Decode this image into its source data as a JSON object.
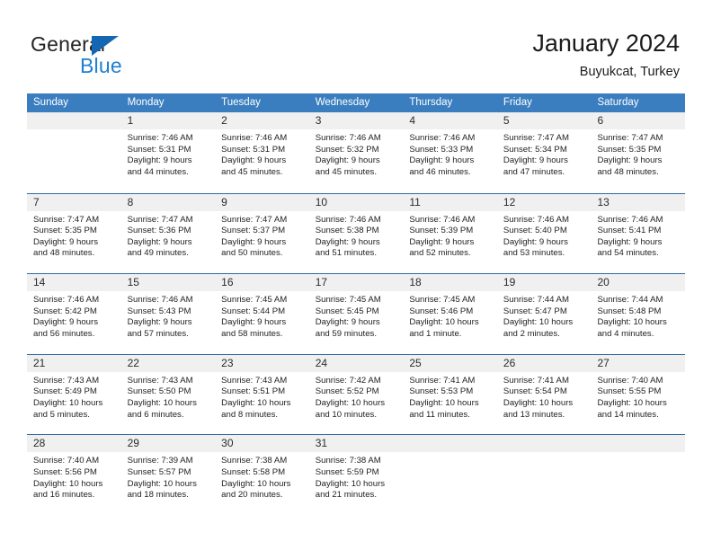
{
  "brand": {
    "name_top": "General",
    "name_bottom": "Blue",
    "triangle_color": "#1567b3",
    "blue_color": "#1f7fd0"
  },
  "header": {
    "title": "January 2024",
    "subtitle": "Buyukcat, Turkey"
  },
  "colors": {
    "header_row_bg": "#3a7ebf",
    "row_divider": "#2e6da4",
    "day_strip_bg": "#f0f0f0",
    "text": "#232323"
  },
  "weekdays": [
    "Sunday",
    "Monday",
    "Tuesday",
    "Wednesday",
    "Thursday",
    "Friday",
    "Saturday"
  ],
  "weeks": [
    [
      {
        "day": "",
        "sunrise": "",
        "sunset": "",
        "daylight1": "",
        "daylight2": ""
      },
      {
        "day": "1",
        "sunrise": "Sunrise: 7:46 AM",
        "sunset": "Sunset: 5:31 PM",
        "daylight1": "Daylight: 9 hours",
        "daylight2": "and 44 minutes."
      },
      {
        "day": "2",
        "sunrise": "Sunrise: 7:46 AM",
        "sunset": "Sunset: 5:31 PM",
        "daylight1": "Daylight: 9 hours",
        "daylight2": "and 45 minutes."
      },
      {
        "day": "3",
        "sunrise": "Sunrise: 7:46 AM",
        "sunset": "Sunset: 5:32 PM",
        "daylight1": "Daylight: 9 hours",
        "daylight2": "and 45 minutes."
      },
      {
        "day": "4",
        "sunrise": "Sunrise: 7:46 AM",
        "sunset": "Sunset: 5:33 PM",
        "daylight1": "Daylight: 9 hours",
        "daylight2": "and 46 minutes."
      },
      {
        "day": "5",
        "sunrise": "Sunrise: 7:47 AM",
        "sunset": "Sunset: 5:34 PM",
        "daylight1": "Daylight: 9 hours",
        "daylight2": "and 47 minutes."
      },
      {
        "day": "6",
        "sunrise": "Sunrise: 7:47 AM",
        "sunset": "Sunset: 5:35 PM",
        "daylight1": "Daylight: 9 hours",
        "daylight2": "and 48 minutes."
      }
    ],
    [
      {
        "day": "7",
        "sunrise": "Sunrise: 7:47 AM",
        "sunset": "Sunset: 5:35 PM",
        "daylight1": "Daylight: 9 hours",
        "daylight2": "and 48 minutes."
      },
      {
        "day": "8",
        "sunrise": "Sunrise: 7:47 AM",
        "sunset": "Sunset: 5:36 PM",
        "daylight1": "Daylight: 9 hours",
        "daylight2": "and 49 minutes."
      },
      {
        "day": "9",
        "sunrise": "Sunrise: 7:47 AM",
        "sunset": "Sunset: 5:37 PM",
        "daylight1": "Daylight: 9 hours",
        "daylight2": "and 50 minutes."
      },
      {
        "day": "10",
        "sunrise": "Sunrise: 7:46 AM",
        "sunset": "Sunset: 5:38 PM",
        "daylight1": "Daylight: 9 hours",
        "daylight2": "and 51 minutes."
      },
      {
        "day": "11",
        "sunrise": "Sunrise: 7:46 AM",
        "sunset": "Sunset: 5:39 PM",
        "daylight1": "Daylight: 9 hours",
        "daylight2": "and 52 minutes."
      },
      {
        "day": "12",
        "sunrise": "Sunrise: 7:46 AM",
        "sunset": "Sunset: 5:40 PM",
        "daylight1": "Daylight: 9 hours",
        "daylight2": "and 53 minutes."
      },
      {
        "day": "13",
        "sunrise": "Sunrise: 7:46 AM",
        "sunset": "Sunset: 5:41 PM",
        "daylight1": "Daylight: 9 hours",
        "daylight2": "and 54 minutes."
      }
    ],
    [
      {
        "day": "14",
        "sunrise": "Sunrise: 7:46 AM",
        "sunset": "Sunset: 5:42 PM",
        "daylight1": "Daylight: 9 hours",
        "daylight2": "and 56 minutes."
      },
      {
        "day": "15",
        "sunrise": "Sunrise: 7:46 AM",
        "sunset": "Sunset: 5:43 PM",
        "daylight1": "Daylight: 9 hours",
        "daylight2": "and 57 minutes."
      },
      {
        "day": "16",
        "sunrise": "Sunrise: 7:45 AM",
        "sunset": "Sunset: 5:44 PM",
        "daylight1": "Daylight: 9 hours",
        "daylight2": "and 58 minutes."
      },
      {
        "day": "17",
        "sunrise": "Sunrise: 7:45 AM",
        "sunset": "Sunset: 5:45 PM",
        "daylight1": "Daylight: 9 hours",
        "daylight2": "and 59 minutes."
      },
      {
        "day": "18",
        "sunrise": "Sunrise: 7:45 AM",
        "sunset": "Sunset: 5:46 PM",
        "daylight1": "Daylight: 10 hours",
        "daylight2": "and 1 minute."
      },
      {
        "day": "19",
        "sunrise": "Sunrise: 7:44 AM",
        "sunset": "Sunset: 5:47 PM",
        "daylight1": "Daylight: 10 hours",
        "daylight2": "and 2 minutes."
      },
      {
        "day": "20",
        "sunrise": "Sunrise: 7:44 AM",
        "sunset": "Sunset: 5:48 PM",
        "daylight1": "Daylight: 10 hours",
        "daylight2": "and 4 minutes."
      }
    ],
    [
      {
        "day": "21",
        "sunrise": "Sunrise: 7:43 AM",
        "sunset": "Sunset: 5:49 PM",
        "daylight1": "Daylight: 10 hours",
        "daylight2": "and 5 minutes."
      },
      {
        "day": "22",
        "sunrise": "Sunrise: 7:43 AM",
        "sunset": "Sunset: 5:50 PM",
        "daylight1": "Daylight: 10 hours",
        "daylight2": "and 6 minutes."
      },
      {
        "day": "23",
        "sunrise": "Sunrise: 7:43 AM",
        "sunset": "Sunset: 5:51 PM",
        "daylight1": "Daylight: 10 hours",
        "daylight2": "and 8 minutes."
      },
      {
        "day": "24",
        "sunrise": "Sunrise: 7:42 AM",
        "sunset": "Sunset: 5:52 PM",
        "daylight1": "Daylight: 10 hours",
        "daylight2": "and 10 minutes."
      },
      {
        "day": "25",
        "sunrise": "Sunrise: 7:41 AM",
        "sunset": "Sunset: 5:53 PM",
        "daylight1": "Daylight: 10 hours",
        "daylight2": "and 11 minutes."
      },
      {
        "day": "26",
        "sunrise": "Sunrise: 7:41 AM",
        "sunset": "Sunset: 5:54 PM",
        "daylight1": "Daylight: 10 hours",
        "daylight2": "and 13 minutes."
      },
      {
        "day": "27",
        "sunrise": "Sunrise: 7:40 AM",
        "sunset": "Sunset: 5:55 PM",
        "daylight1": "Daylight: 10 hours",
        "daylight2": "and 14 minutes."
      }
    ],
    [
      {
        "day": "28",
        "sunrise": "Sunrise: 7:40 AM",
        "sunset": "Sunset: 5:56 PM",
        "daylight1": "Daylight: 10 hours",
        "daylight2": "and 16 minutes."
      },
      {
        "day": "29",
        "sunrise": "Sunrise: 7:39 AM",
        "sunset": "Sunset: 5:57 PM",
        "daylight1": "Daylight: 10 hours",
        "daylight2": "and 18 minutes."
      },
      {
        "day": "30",
        "sunrise": "Sunrise: 7:38 AM",
        "sunset": "Sunset: 5:58 PM",
        "daylight1": "Daylight: 10 hours",
        "daylight2": "and 20 minutes."
      },
      {
        "day": "31",
        "sunrise": "Sunrise: 7:38 AM",
        "sunset": "Sunset: 5:59 PM",
        "daylight1": "Daylight: 10 hours",
        "daylight2": "and 21 minutes."
      },
      {
        "day": "",
        "sunrise": "",
        "sunset": "",
        "daylight1": "",
        "daylight2": ""
      },
      {
        "day": "",
        "sunrise": "",
        "sunset": "",
        "daylight1": "",
        "daylight2": ""
      },
      {
        "day": "",
        "sunrise": "",
        "sunset": "",
        "daylight1": "",
        "daylight2": ""
      }
    ]
  ]
}
